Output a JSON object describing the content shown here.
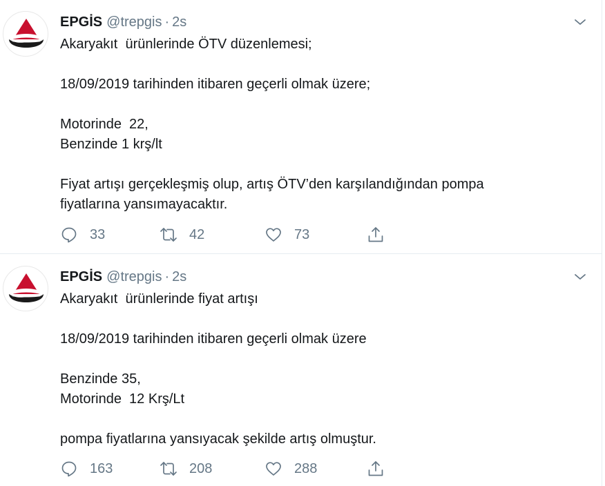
{
  "tweets": [
    {
      "author": {
        "name": "EPGİS",
        "handle": "@trepgis",
        "separator": "·",
        "time": "2s"
      },
      "text": "Akaryakıt  ürünlerinde ÖTV düzenlemesi;\n\n18/09/2019 tarihinden itibaren geçerli olmak üzere;\n\nMotorinde  22,\nBenzinde 1 krş/lt\n\nFiyat artışı gerçekleşmiş olup, artış ÖTV’den karşılandığından pompa\nfiyatlarına yansımayacaktır.",
      "stats": {
        "replies": "33",
        "retweets": "42",
        "likes": "73"
      }
    },
    {
      "author": {
        "name": "EPGİS",
        "handle": "@trepgis",
        "separator": "·",
        "time": "2s"
      },
      "text": "Akaryakıt  ürünlerinde fiyat artışı\n\n18/09/2019 tarihinden itibaren geçerli olmak üzere\n\nBenzinde 35,\nMotorinde  12 Krş/Lt\n\npompa fiyatlarına yansıyacak şekilde artış olmuştur.",
      "stats": {
        "replies": "163",
        "retweets": "208",
        "likes": "288"
      }
    }
  ],
  "icons": {
    "reply": "reply-icon",
    "retweet": "retweet-icon",
    "like": "heart-icon",
    "share": "share-icon",
    "menu": "chevron-down-icon",
    "avatar": "epgis-logo"
  },
  "colors": {
    "text": "#14171a",
    "secondary": "#657786",
    "divider": "#e6ecf0",
    "logo_red": "#c8102e",
    "logo_dark": "#1a1a1a"
  }
}
